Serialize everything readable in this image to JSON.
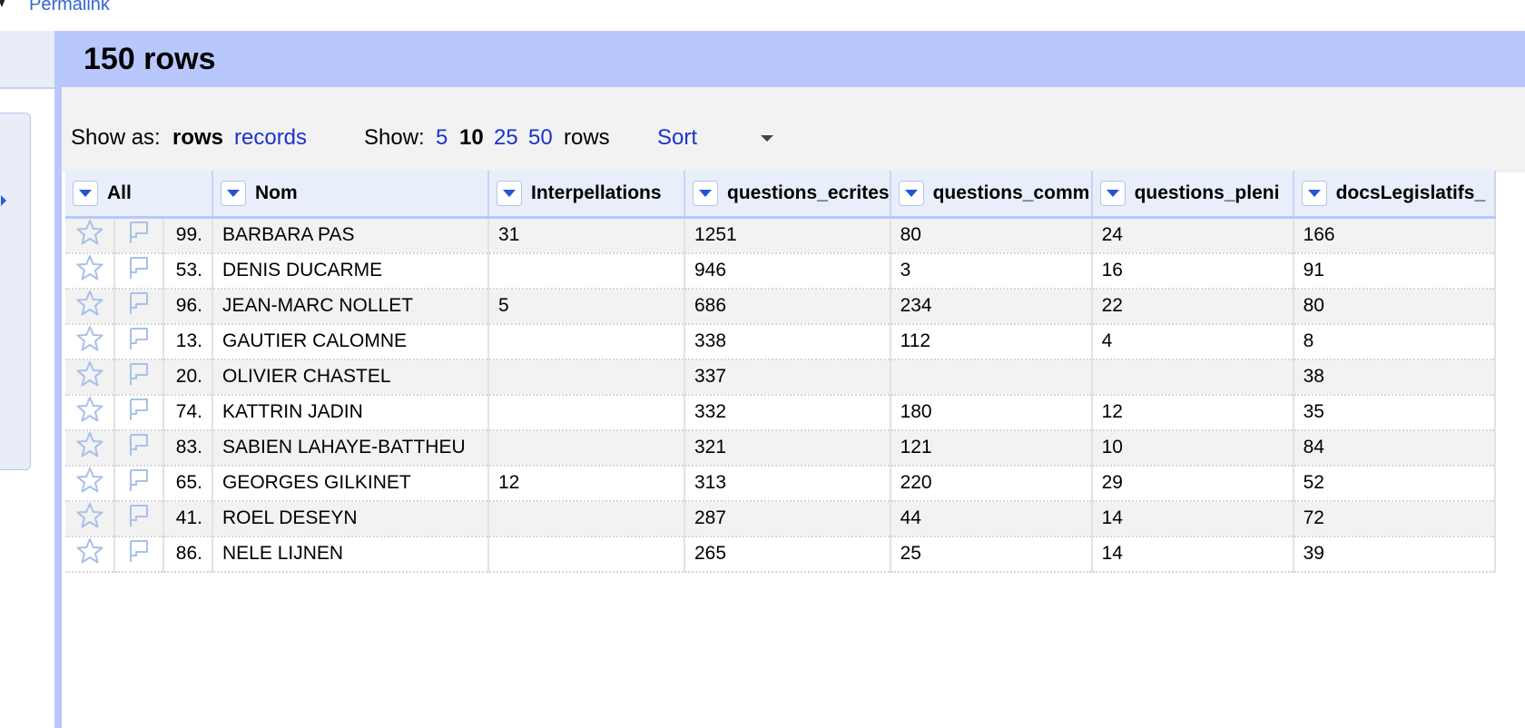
{
  "permalink": "Permalink",
  "title": "150 rows",
  "controls": {
    "show_as_label": "Show as:",
    "rows_mode": "rows",
    "records_mode": "records",
    "show_label": "Show:",
    "page_sizes": [
      "5",
      "10",
      "25",
      "50"
    ],
    "selected_page_size": "10",
    "rows_suffix": "rows",
    "sort_label": "Sort"
  },
  "columns": [
    "All",
    "Nom",
    "Interpellations",
    "questions_ecrites",
    "questions_comm",
    "questions_pleni",
    "docsLegislatifs_"
  ],
  "rows": [
    {
      "idx": "99.",
      "nom": "BARBARA PAS",
      "interpellations": "31",
      "questions_ecrites": "1251",
      "questions_comm": "80",
      "questions_pleni": "24",
      "docs": "166"
    },
    {
      "idx": "53.",
      "nom": "DENIS DUCARME",
      "interpellations": "",
      "questions_ecrites": "946",
      "questions_comm": "3",
      "questions_pleni": "16",
      "docs": "91"
    },
    {
      "idx": "96.",
      "nom": "JEAN-MARC NOLLET",
      "interpellations": "5",
      "questions_ecrites": "686",
      "questions_comm": "234",
      "questions_pleni": "22",
      "docs": "80"
    },
    {
      "idx": "13.",
      "nom": "GAUTIER CALOMNE",
      "interpellations": "",
      "questions_ecrites": "338",
      "questions_comm": "112",
      "questions_pleni": "4",
      "docs": "8"
    },
    {
      "idx": "20.",
      "nom": "OLIVIER CHASTEL",
      "interpellations": "",
      "questions_ecrites": "337",
      "questions_comm": "",
      "questions_pleni": "",
      "docs": "38"
    },
    {
      "idx": "74.",
      "nom": "KATTRIN JADIN",
      "interpellations": "",
      "questions_ecrites": "332",
      "questions_comm": "180",
      "questions_pleni": "12",
      "docs": "35"
    },
    {
      "idx": "83.",
      "nom": "SABIEN LAHAYE-BATTHEU",
      "interpellations": "",
      "questions_ecrites": "321",
      "questions_comm": "121",
      "questions_pleni": "10",
      "docs": "84"
    },
    {
      "idx": "65.",
      "nom": "GEORGES GILKINET",
      "interpellations": "12",
      "questions_ecrites": "313",
      "questions_comm": "220",
      "questions_pleni": "29",
      "docs": "52"
    },
    {
      "idx": "41.",
      "nom": "ROEL DESEYN",
      "interpellations": "",
      "questions_ecrites": "287",
      "questions_comm": "44",
      "questions_pleni": "14",
      "docs": "72"
    },
    {
      "idx": "86.",
      "nom": "NELE LIJNEN",
      "interpellations": "",
      "questions_ecrites": "265",
      "questions_comm": "25",
      "questions_pleni": "14",
      "docs": "39"
    }
  ],
  "colors": {
    "header_blue": "#b9c8fc",
    "link_blue": "#1a33cc",
    "dropdown_arrow": "#2454d3"
  },
  "icons": {
    "star": "star-icon",
    "flag": "flag-icon",
    "dropdown": "chevron-down-icon"
  }
}
